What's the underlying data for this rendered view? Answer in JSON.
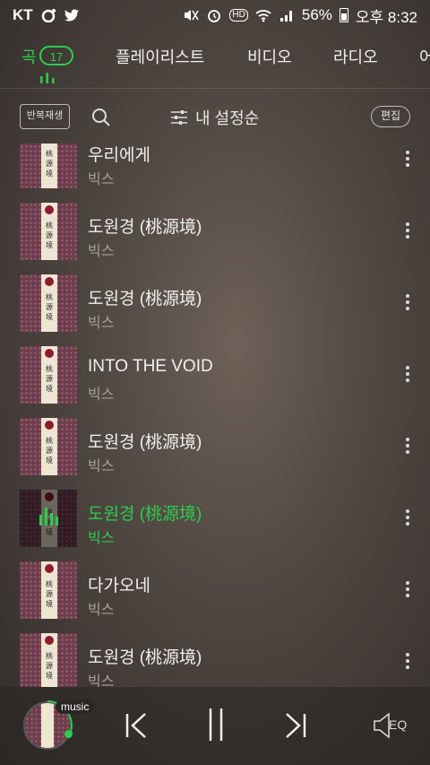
{
  "status_bar": {
    "carrier": "KT",
    "battery": "56%",
    "time": "오후 8:32",
    "hd_badge": "HD"
  },
  "tabs": {
    "items": [
      {
        "label": "곡",
        "count": "17",
        "active": true
      },
      {
        "label": "플레이리스트"
      },
      {
        "label": "비디오"
      },
      {
        "label": "라디오"
      },
      {
        "label": "어"
      }
    ]
  },
  "toolbar": {
    "repeat_label": "반복재생",
    "sort_label": "내 설정순",
    "edit_label": "편집"
  },
  "album_art": {
    "cover_text": "桃源境"
  },
  "songs": [
    {
      "title": "우리에게",
      "artist": "빅스"
    },
    {
      "title": "도원경 (桃源境)",
      "artist": "빅스"
    },
    {
      "title": "도원경 (桃源境)",
      "artist": "빅스"
    },
    {
      "title": "INTO THE VOID",
      "artist": "빅스"
    },
    {
      "title": "도원경 (桃源境)",
      "artist": "빅스"
    },
    {
      "title": "도원경 (桃源境)",
      "artist": "빅스",
      "playing": true
    },
    {
      "title": "다가오네",
      "artist": "빅스"
    },
    {
      "title": "도원경 (桃源境)",
      "artist": "빅스"
    }
  ],
  "player": {
    "music_tag": "music",
    "eq_label": "EQ"
  },
  "colors": {
    "accent": "#2ccd4c"
  }
}
